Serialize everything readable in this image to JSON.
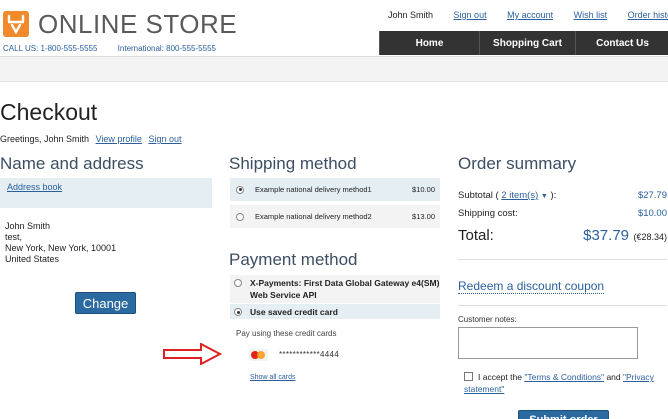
{
  "header": {
    "logo_text": "ONLINE STORE",
    "phone_label": "CALL US: 1-800-555-5555",
    "intl_label": "International: 800-555-5555",
    "user_name": "John Smith",
    "links": {
      "sign_out": "Sign out",
      "my_account": "My account",
      "wish_list": "Wish list",
      "order_history": "Order history"
    },
    "nav": {
      "home": "Home",
      "cart": "Shopping Cart",
      "contact": "Contact Us"
    }
  },
  "page": {
    "title": "Checkout",
    "greeting": "Greetings, John Smith",
    "view_profile": "View profile",
    "sign_out": "Sign out"
  },
  "address": {
    "title": "Name and address",
    "address_book": "Address book",
    "name": "John Smith",
    "line1": "test,",
    "line2": "New York, New York, 10001",
    "country": "United States",
    "change_label": "Change"
  },
  "shipping": {
    "title": "Shipping method",
    "methods": [
      {
        "name": "Example national delivery method1",
        "price": "$10.00",
        "selected": true
      },
      {
        "name": "Example national delivery method2",
        "price": "$13.00",
        "selected": false
      }
    ]
  },
  "payment": {
    "title": "Payment method",
    "options": [
      {
        "label": "X-Payments: First Data Global Gateway e4(SM) Web Service API",
        "selected": false
      },
      {
        "label": "Use saved credit card",
        "selected": true
      }
    ],
    "pay_using": "Pay using these credit cards",
    "card_number": "************4444",
    "card_icon": "mastercard-icon",
    "show_all": "Show all cards"
  },
  "summary": {
    "title": "Order summary",
    "subtotal_label": "Subtotal (",
    "items_link": "2 item(s)",
    "subtotal_suffix": "):",
    "subtotal": "$27.79",
    "shipping_label": "Shipping cost:",
    "shipping": "$10.00",
    "total_label": "Total:",
    "total": "$37.79",
    "total_alt": "(€28.34)",
    "coupon": "Redeem a discount coupon",
    "notes_label": "Customer notes:",
    "terms_prefix": "I accept the",
    "terms_link": "\"Terms & Conditions\"",
    "terms_and": "and",
    "privacy_link": "\"Privacy statement\"",
    "submit_label": "Submit order"
  },
  "colors": {
    "accent": "#2a6aa0",
    "logo": "#f18a2b",
    "nav": "#333333",
    "highlight_arrow": "#e02020"
  }
}
